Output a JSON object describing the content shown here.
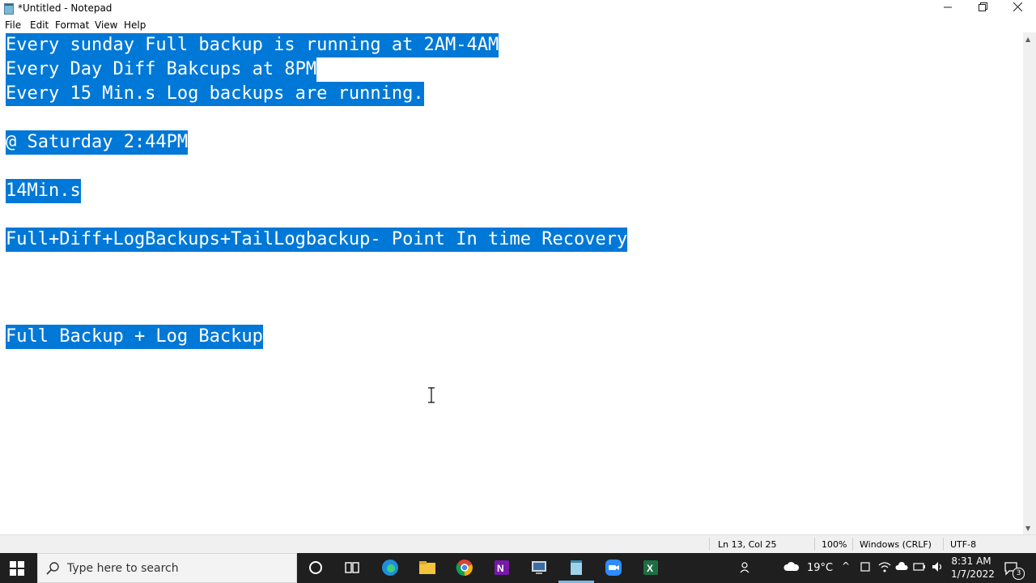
{
  "window": {
    "title": "*Untitled - Notepad",
    "minimize_icon": "minimize-icon",
    "maximize_icon": "restore-icon",
    "close_icon": "close-icon"
  },
  "menu": {
    "items": [
      "File",
      "Edit",
      "Format",
      "View",
      "Help"
    ]
  },
  "editor": {
    "lines": [
      "Every sunday Full backup is running at 2AM-4AM",
      "Every Day Diff Bakcups at 8PM",
      "Every 15 Min.s Log backups are running.",
      "",
      "@ Saturday 2:44PM",
      "",
      "14Min.s",
      "",
      "Full+Diff+LogBackups+TailLogbackup- Point In time Recovery",
      "",
      "",
      "",
      "Full Backup + Log Backup"
    ],
    "selection_color": "#0078d7"
  },
  "status": {
    "position": "Ln 13, Col 25",
    "zoom": "100%",
    "line_ending": "Windows (CRLF)",
    "encoding": "UTF-8"
  },
  "taskbar": {
    "search_placeholder": "Type here to search",
    "weather": "19°C",
    "time": "8:31 AM",
    "date": "1/7/2022",
    "notification_count": "3",
    "apps": [
      "cortana-icon",
      "task-view-icon",
      "edge-icon",
      "file-explorer-icon",
      "chrome-icon",
      "onenote-icon",
      "sql-server-icon",
      "notepad-icon",
      "zoom-icon",
      "excel-icon"
    ]
  }
}
